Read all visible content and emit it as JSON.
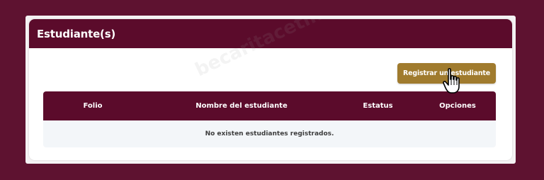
{
  "card": {
    "title": "Estudiante(s)"
  },
  "actions": {
    "register_label": "Registrar un estudiante"
  },
  "table": {
    "columns": [
      "Folio",
      "Nombre del estudiante",
      "Estatus",
      "Opciones"
    ],
    "empty_message": "No existen estudiantes registrados."
  },
  "watermark": "becaritacetina.org",
  "colors": {
    "background": "#5e1230",
    "header": "#5b0b2b",
    "button": "#a07b2e"
  }
}
